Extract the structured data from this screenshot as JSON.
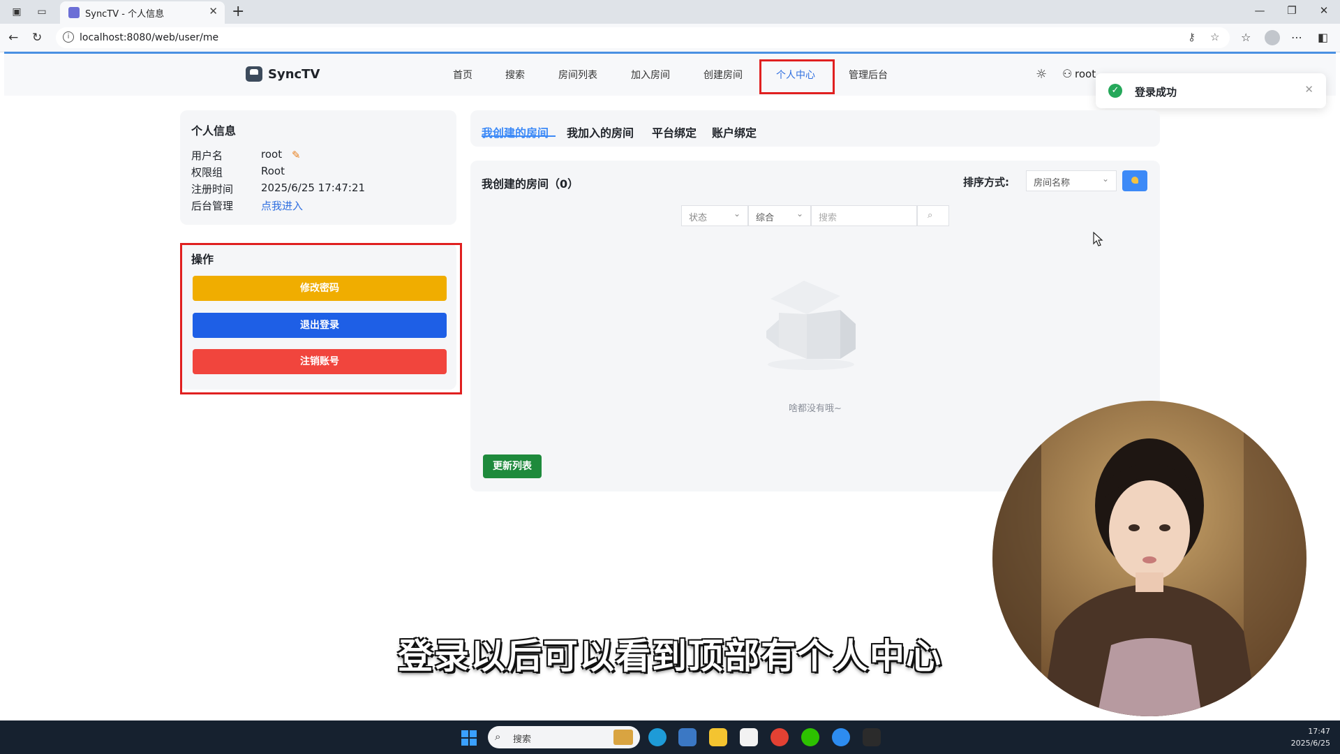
{
  "browser": {
    "tab_title": "SyncTV - 个人信息",
    "url": "localhost:8080/web/user/me"
  },
  "app": {
    "logo": "SyncTV",
    "nav": [
      "首页",
      "搜索",
      "房间列表",
      "加入房间",
      "创建房间",
      "个人中心",
      "管理后台"
    ],
    "active_nav": "个人中心",
    "user": "root"
  },
  "toast": {
    "text": "登录成功"
  },
  "profile": {
    "title": "个人信息",
    "rows": [
      {
        "label": "用户名",
        "value": "root"
      },
      {
        "label": "权限组",
        "value": "Root"
      },
      {
        "label": "注册时间",
        "value": "2025/6/25 17:47:21"
      },
      {
        "label": "后台管理",
        "value": "点我进入"
      }
    ]
  },
  "operations": {
    "title": "操作",
    "change_password": "修改密码",
    "logout": "退出登录",
    "delete_account": "注销账号"
  },
  "room_tabs": [
    "我创建的房间",
    "我加入的房间",
    "平台绑定",
    "账户绑定"
  ],
  "rooms_panel": {
    "title": "我创建的房间（0）",
    "sort_label": "排序方式:",
    "sort_value": "房间名称",
    "status_filter": "状态",
    "type_filter": "综合",
    "search_placeholder": "搜索",
    "empty_text": "啥都没有哦~",
    "refresh": "更新列表"
  },
  "subtitle": "登录以后可以看到顶部有个人中心",
  "taskbar": {
    "search": "搜索",
    "time": "17:47",
    "date": "2025/6/25"
  },
  "colors": {
    "accent": "#3d8af7",
    "warning": "#f0ad00",
    "primary": "#1e5fe6",
    "danger": "#f1453d",
    "success": "#1e8a3c",
    "highlight": "#e02020"
  }
}
